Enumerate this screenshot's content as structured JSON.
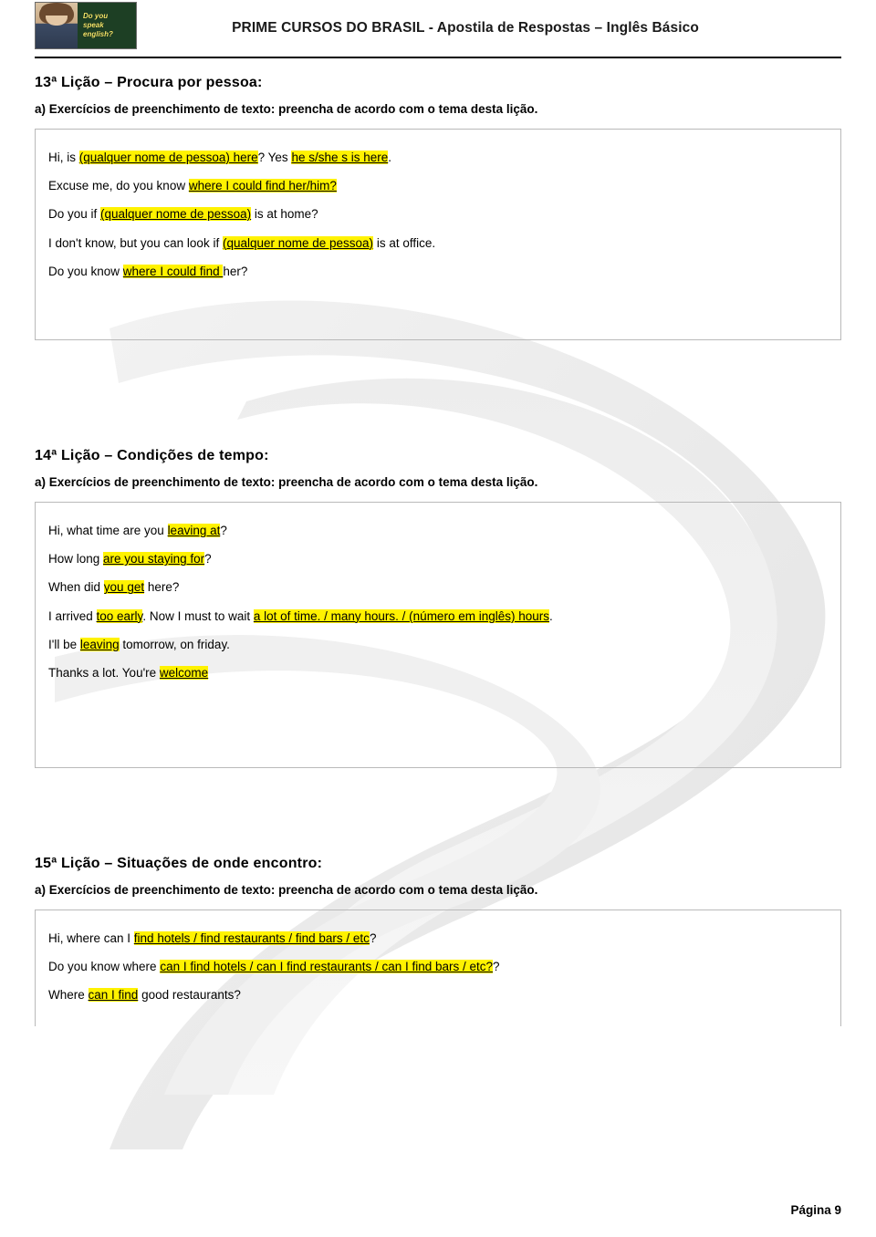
{
  "header": {
    "title": "PRIME CURSOS DO BRASIL -  Apostila de Respostas – Inglês Básico",
    "logo_text_line1": "Do you",
    "logo_text_line2": "speak",
    "logo_text_line3": "english?"
  },
  "lessons": [
    {
      "title": "13ª Lição – Procura por pessoa:",
      "subtitle": "a) Exercícios de preenchimento de texto: preencha de acordo com o tema desta lição.",
      "lines": [
        [
          {
            "t": "Hi, is ",
            "hl": false
          },
          {
            "t": "(qualquer nome de pessoa) here",
            "hl": true
          },
          {
            "t": "? Yes ",
            "hl": false
          },
          {
            "t": "he s/she s is here",
            "hl": true
          },
          {
            "t": ".",
            "hl": false
          }
        ],
        [
          {
            "t": "Excuse me, do you know ",
            "hl": false
          },
          {
            "t": "where I could find her/him?",
            "hl": true
          }
        ],
        [
          {
            "t": "Do you if ",
            "hl": false
          },
          {
            "t": " (qualquer nome de pessoa)",
            "hl": true
          },
          {
            "t": " is at home?",
            "hl": false
          }
        ],
        [
          {
            "t": "I don't know, but you can look if ",
            "hl": false
          },
          {
            "t": "(qualquer nome de pessoa)",
            "hl": true
          },
          {
            "t": " is at office.",
            "hl": false
          }
        ],
        [
          {
            "t": "Do you know ",
            "hl": false
          },
          {
            "t": "where I could find ",
            "hl": true
          },
          {
            "t": "her?",
            "hl": false
          }
        ]
      ]
    },
    {
      "title": "14ª Lição – Condições de tempo:",
      "subtitle": "a) Exercícios de preenchimento de texto: preencha de acordo com o tema desta lição.",
      "lines": [
        [
          {
            "t": "Hi, what time are you ",
            "hl": false
          },
          {
            "t": "leaving at",
            "hl": true
          },
          {
            "t": "?",
            "hl": false
          }
        ],
        [
          {
            "t": "How long ",
            "hl": false
          },
          {
            "t": "are you staying for",
            "hl": true
          },
          {
            "t": "?",
            "hl": false
          }
        ],
        [
          {
            "t": "When did ",
            "hl": false
          },
          {
            "t": " you get",
            "hl": true
          },
          {
            "t": " here?",
            "hl": false
          }
        ],
        [
          {
            "t": "I arrived ",
            "hl": false
          },
          {
            "t": "too early",
            "hl": true
          },
          {
            "t": ". Now I must to wait ",
            "hl": false
          },
          {
            "t": "a lot of time.   /  many hours.   /  (número em inglês) hours",
            "hl": true
          },
          {
            "t": ".",
            "hl": false
          }
        ],
        [
          {
            "t": "I'll be ",
            "hl": false
          },
          {
            "t": "leaving",
            "hl": true
          },
          {
            "t": " tomorrow, on friday.",
            "hl": false
          }
        ],
        [
          {
            "t": "Thanks a lot. You're ",
            "hl": false
          },
          {
            "t": "welcome",
            "hl": true
          }
        ]
      ]
    },
    {
      "title": "15ª Lição – Situações de onde encontro:",
      "subtitle": "a) Exercícios de preenchimento de texto: preencha de acordo com o tema desta lição.",
      "lines": [
        [
          {
            "t": "Hi, where can I ",
            "hl": false
          },
          {
            "t": "find hotels / find restaurants / find bars / etc",
            "hl": true
          },
          {
            "t": "?",
            "hl": false
          }
        ],
        [
          {
            "t": "Do you know where ",
            "hl": false
          },
          {
            "t": " can I find hotels / can I find restaurants / can I find bars / etc?",
            "hl": true
          },
          {
            "t": "?",
            "hl": false
          }
        ],
        [
          {
            "t": "Where ",
            "hl": false
          },
          {
            "t": " can I find",
            "hl": true
          },
          {
            "t": " good restaurants?",
            "hl": false
          }
        ]
      ]
    }
  ],
  "footer": {
    "page_label": "Página 9"
  },
  "colors": {
    "highlight": "#fff200",
    "box_border": "#b9b9b9",
    "rule": "#000000"
  }
}
